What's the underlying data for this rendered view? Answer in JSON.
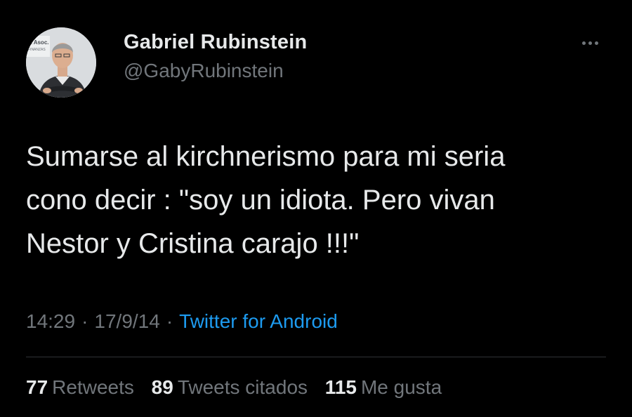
{
  "author": {
    "display_name": "Gabriel Rubinstein",
    "handle": "@GabyRubinstein",
    "avatar_sign_text": "& Asoc.",
    "avatar_sign_subtext": "FINANZAS"
  },
  "tweet": {
    "lines": [
      "Sumarse al kirchnerismo para mi seria",
      "cono decir : \"soy un idiota. Pero vivan",
      "Nestor y Cristina carajo !!!\""
    ],
    "time": "14:29",
    "separator": "·",
    "date": "17/9/14",
    "source": "Twitter for Android"
  },
  "stats": {
    "retweets_count": "77",
    "retweets_label": "Retweets",
    "quotes_count": "89",
    "quotes_label": "Tweets citados",
    "likes_count": "115",
    "likes_label": "Me gusta"
  },
  "colors": {
    "background": "#000000",
    "text_primary": "#e7e9ea",
    "text_secondary": "#71767b",
    "link": "#1d9bf0",
    "divider": "#2f3336"
  },
  "icons": {
    "more": "more-horizontal-icon"
  }
}
